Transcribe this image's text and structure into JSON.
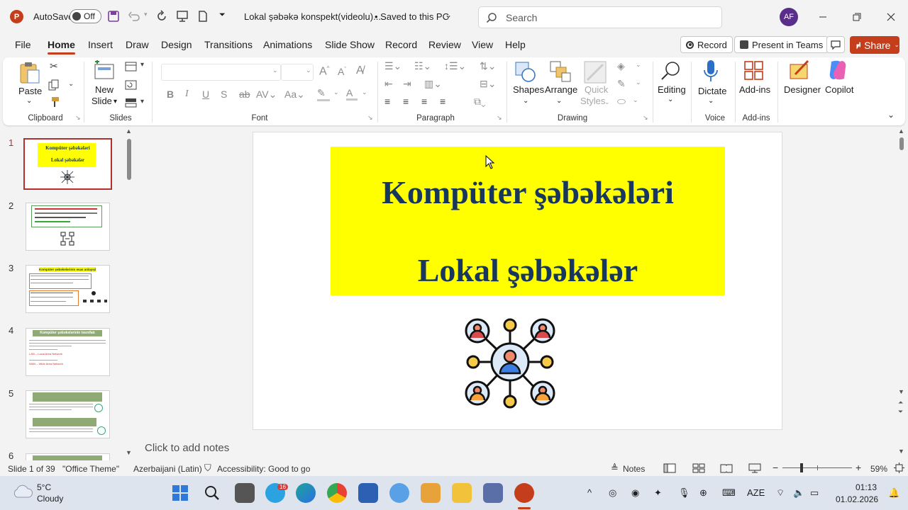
{
  "titlebar": {
    "autosave_label": "AutoSave",
    "autosave_state": "Off",
    "document_title": "Lokal şəbəkə konspekt(videolu)....",
    "save_status": "• Saved to this PC",
    "search_placeholder": "Search",
    "user_initials": "AF"
  },
  "menu": {
    "tabs": [
      "File",
      "Home",
      "Insert",
      "Draw",
      "Design",
      "Transitions",
      "Animations",
      "Slide Show",
      "Record",
      "Review",
      "View",
      "Help"
    ],
    "active": "Home",
    "record_button": "Record",
    "present_button": "Present in Teams",
    "share_button": "Share"
  },
  "ribbon": {
    "clipboard": {
      "paste": "Paste",
      "group": "Clipboard"
    },
    "slides": {
      "new_slide_line1": "New",
      "new_slide_line2": "Slide",
      "group": "Slides"
    },
    "font": {
      "group": "Font"
    },
    "paragraph": {
      "group": "Paragraph"
    },
    "drawing": {
      "shapes": "Shapes",
      "arrange": "Arrange",
      "quick_styles_1": "Quick",
      "quick_styles_2": "Styles",
      "group": "Drawing"
    },
    "editing": {
      "label": "Editing"
    },
    "voice": {
      "dictate": "Dictate",
      "group": "Voice"
    },
    "addins": {
      "label": "Add-ins",
      "group": "Add-ins"
    },
    "designer": "Designer",
    "copilot": "Copilot"
  },
  "thumbnails": {
    "numbers": [
      "1",
      "2",
      "3",
      "4",
      "5",
      "6"
    ],
    "slide1_line1": "Kompüter şəbəkələri",
    "slide1_line2": "Lokal şəbəkələr",
    "slide3_title": "Kompüter şəbəkələrinin əsas anlayışları",
    "slide4_title": "Kompüter şəbəkələrinin təsnifatı",
    "slide4_line1": "LAN – Local Area Network",
    "slide4_line2": "WAN – Wide Area Network"
  },
  "slide": {
    "title_line1": "Kompüter şəbəkələri",
    "title_line2": "Lokal şəbəkələr"
  },
  "notes_placeholder": "Click to add notes",
  "statusbar": {
    "slide_position": "Slide 1 of 39",
    "theme": "\"Office Theme\"",
    "language": "Azerbaijani (Latin)",
    "accessibility": "Accessibility: Good to go",
    "notes": "Notes",
    "zoom": "59%"
  },
  "taskbar": {
    "weather_temp": "5°C",
    "weather_desc": "Cloudy",
    "telegram_badge": "16",
    "language": "AZE",
    "time": "01:13",
    "date": "01.02.2026"
  },
  "colors": {
    "accent": "#c43e1c",
    "title_fill": "#ffff00",
    "title_text": "#17375e",
    "selected_thumb_border": "#b5302d"
  }
}
